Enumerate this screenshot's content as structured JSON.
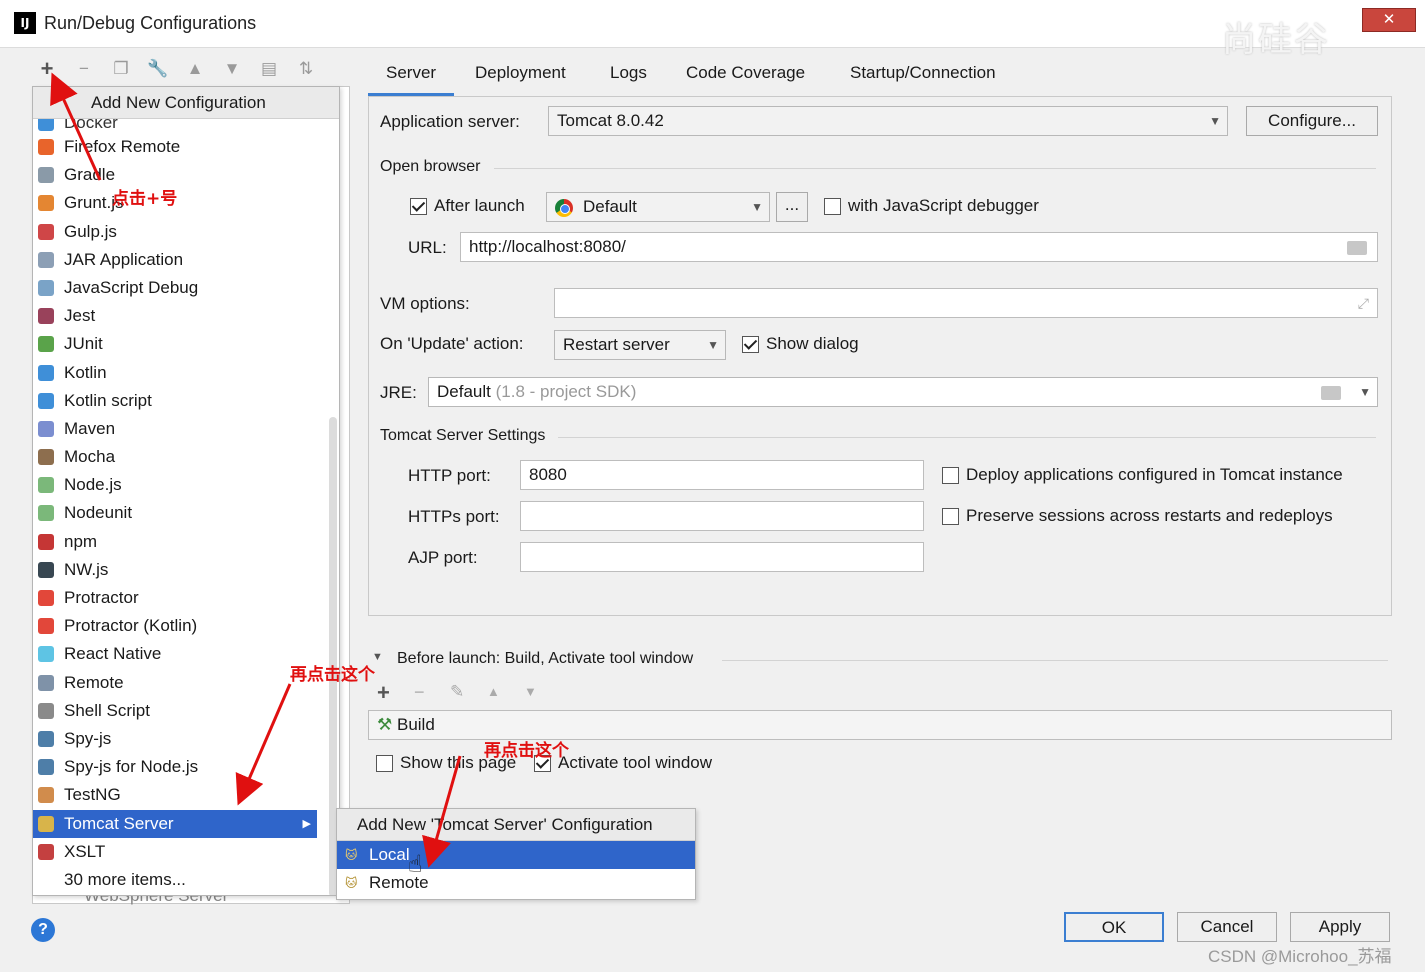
{
  "window": {
    "title": "Run/Debug Configurations",
    "app_icon": "IJ",
    "brand_watermark": "尚硅谷",
    "close_label": "✕"
  },
  "toolbar": {
    "icons": [
      "add-icon",
      "remove-icon",
      "copy-icon",
      "wrench-icon",
      "move-up-icon",
      "move-down-icon",
      "folder-add-icon",
      "sort-icon"
    ]
  },
  "popup": {
    "header": "Add New Configuration",
    "partial_top": "Docker",
    "items": [
      {
        "label": "Firefox Remote",
        "icon": "firefox-icon",
        "color": "#e8642b"
      },
      {
        "label": "Gradle",
        "icon": "gradle-icon",
        "color": "#8a9aa8"
      },
      {
        "label": "Grunt.js",
        "icon": "grunt-icon",
        "color": "#e48632"
      },
      {
        "label": "Gulp.js",
        "icon": "gulp-icon",
        "color": "#cf4647"
      },
      {
        "label": "JAR Application",
        "icon": "jar-icon",
        "color": "#8c9fb5"
      },
      {
        "label": "JavaScript Debug",
        "icon": "js-debug-icon",
        "color": "#7aa3c7"
      },
      {
        "label": "Jest",
        "icon": "jest-icon",
        "color": "#99425b"
      },
      {
        "label": "JUnit",
        "icon": "junit-icon",
        "color": "#5aa34a"
      },
      {
        "label": "Kotlin",
        "icon": "kotlin-icon",
        "color": "#3f8fd8"
      },
      {
        "label": "Kotlin script",
        "icon": "kotlin-script-icon",
        "color": "#3f8fd8"
      },
      {
        "label": "Maven",
        "icon": "maven-icon",
        "color": "#7b8ed0"
      },
      {
        "label": "Mocha",
        "icon": "mocha-icon",
        "color": "#8d6e4e"
      },
      {
        "label": "Node.js",
        "icon": "nodejs-icon",
        "color": "#7bb87a"
      },
      {
        "label": "Nodeunit",
        "icon": "nodeunit-icon",
        "color": "#7bb87a"
      },
      {
        "label": "npm",
        "icon": "npm-icon",
        "color": "#c53635"
      },
      {
        "label": "NW.js",
        "icon": "nwjs-icon",
        "color": "#384752"
      },
      {
        "label": "Protractor",
        "icon": "protractor-icon",
        "color": "#e2473a"
      },
      {
        "label": "Protractor (Kotlin)",
        "icon": "protractor-icon",
        "color": "#e2473a"
      },
      {
        "label": "React Native",
        "icon": "react-icon",
        "color": "#5ec4e4"
      },
      {
        "label": "Remote",
        "icon": "remote-icon",
        "color": "#7f92a8"
      },
      {
        "label": "Shell Script",
        "icon": "shell-icon",
        "color": "#8a8a8a"
      },
      {
        "label": "Spy-js",
        "icon": "spyjs-icon",
        "color": "#4e7ea8"
      },
      {
        "label": "Spy-js for Node.js",
        "icon": "spyjs-icon",
        "color": "#4e7ea8"
      },
      {
        "label": "TestNG",
        "icon": "testng-icon",
        "color": "#d18c4c"
      },
      {
        "label": "Tomcat Server",
        "icon": "tomcat-icon",
        "color": "#d8b44a",
        "selected": true
      },
      {
        "label": "XSLT",
        "icon": "xslt-icon",
        "color": "#c44040"
      },
      {
        "label": "30 more items...",
        "icon": "",
        "color": ""
      }
    ],
    "tree_underneath": "WebSphere Server"
  },
  "submenu": {
    "header": "Add New 'Tomcat Server' Configuration",
    "items": [
      {
        "label": "Local",
        "selected": true
      },
      {
        "label": "Remote",
        "selected": false
      }
    ]
  },
  "tabs": [
    "Server",
    "Deployment",
    "Logs",
    "Code Coverage",
    "Startup/Connection"
  ],
  "server": {
    "app_server_label": "Application server:",
    "app_server_value": "Tomcat 8.0.42",
    "configure_button": "Configure...",
    "open_browser_title": "Open browser",
    "after_launch_label": "After launch",
    "after_launch_checked": true,
    "browser_value": "Default",
    "browse_button": "...",
    "js_debugger_label": "with JavaScript debugger",
    "js_debugger_checked": false,
    "url_label": "URL:",
    "url_value": "http://localhost:8080/",
    "vm_options_label": "VM options:",
    "vm_options_value": "",
    "update_action_label": "On 'Update' action:",
    "update_action_value": "Restart server",
    "show_dialog_label": "Show dialog",
    "show_dialog_checked": true,
    "jre_label": "JRE:",
    "jre_value": "Default",
    "jre_hint": "(1.8 - project SDK)",
    "tomcat_settings_title": "Tomcat Server Settings",
    "http_port_label": "HTTP port:",
    "http_port_value": "8080",
    "https_port_label": "HTTPs port:",
    "https_port_value": "",
    "ajp_port_label": "AJP port:",
    "ajp_port_value": "",
    "deploy_label": "Deploy applications configured in Tomcat instance",
    "deploy_checked": false,
    "preserve_label": "Preserve sessions across restarts and redeploys",
    "preserve_checked": false
  },
  "before_launch": {
    "title": "Before launch: Build, Activate tool window",
    "task": "Build",
    "show_page_label": "Show this page",
    "show_page_checked": false,
    "activate_label": "Activate tool window",
    "activate_checked": true
  },
  "buttons": {
    "ok": "OK",
    "cancel": "Cancel",
    "apply": "Apply"
  },
  "annotations": {
    "click_plus": "点击+号",
    "click_this_1": "再点击这个",
    "click_this_2": "再点击这个"
  },
  "watermark": "CSDN @Microhoo_苏福"
}
